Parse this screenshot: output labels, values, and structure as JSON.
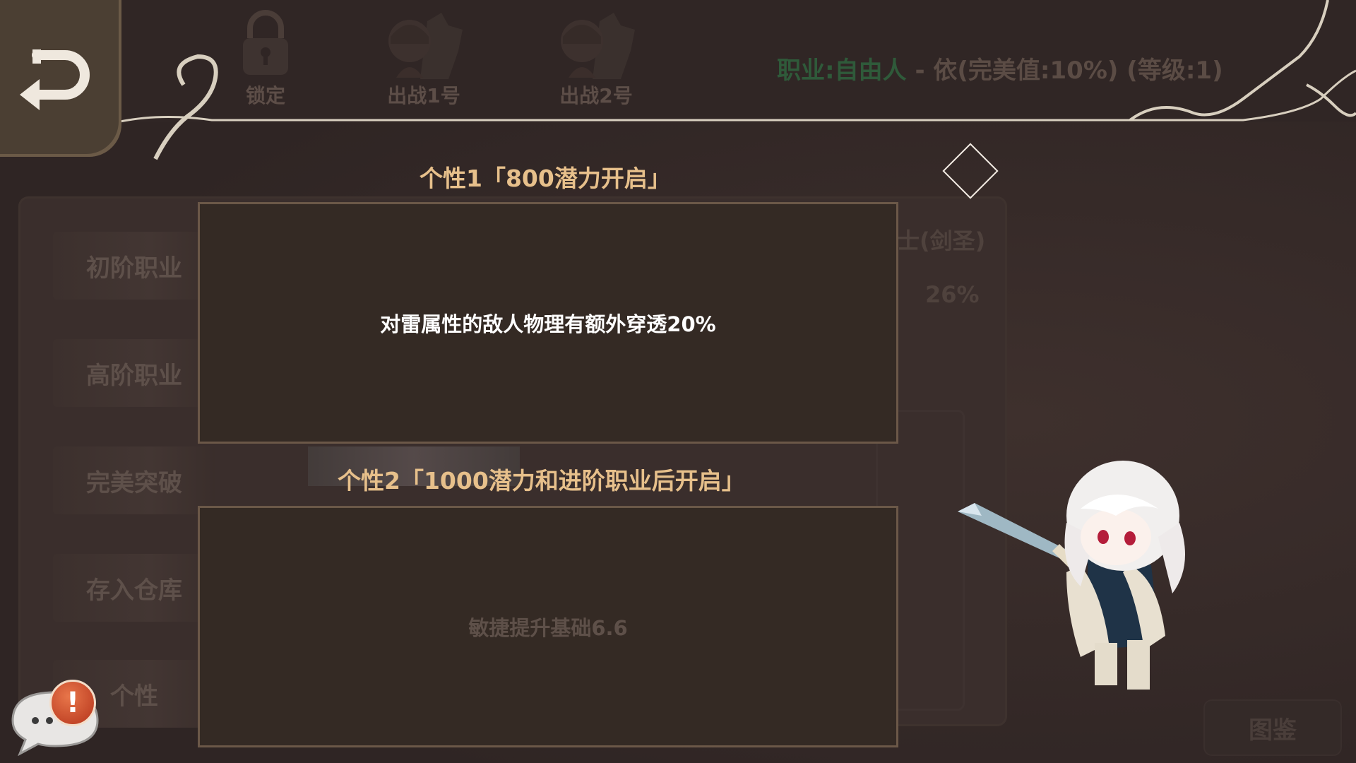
{
  "header": {
    "back_icon": "return-arrow-icon",
    "tabs": [
      {
        "label": "锁定",
        "icon": "lock-icon"
      },
      {
        "label": "出战1号",
        "icon": "character-portrait-icon"
      },
      {
        "label": "出战2号",
        "icon": "character-portrait-icon"
      }
    ],
    "job_prefix": "职业:自由人",
    "job_suffix": " - 依(完美值:10%) (等级:1)"
  },
  "side_menu": {
    "items": [
      "初阶职业",
      "高阶职业",
      "完美突破",
      "存入仓库",
      "个性"
    ]
  },
  "background_stats": {
    "class_name": "士(剑圣)",
    "percent": "26%"
  },
  "codex_button": "图鉴",
  "popup": {
    "trait1": {
      "title": "个性1「800潜力开启」",
      "description": "对雷属性的敌人物理有额外穿透20%"
    },
    "trait2": {
      "title": "个性2「1000潜力和进阶职业后开启」",
      "description": "敏捷提升基础6.6"
    },
    "close_icon": "diamond-close-icon"
  },
  "chat": {
    "icon": "chat-bubble-icon",
    "alert": "!"
  },
  "colors": {
    "background": "#2f2524",
    "popup_box": "#342a24",
    "title_gold": "#e7c08b",
    "job_green": "#2f5a3a",
    "alert_orange": "#c9452a"
  }
}
